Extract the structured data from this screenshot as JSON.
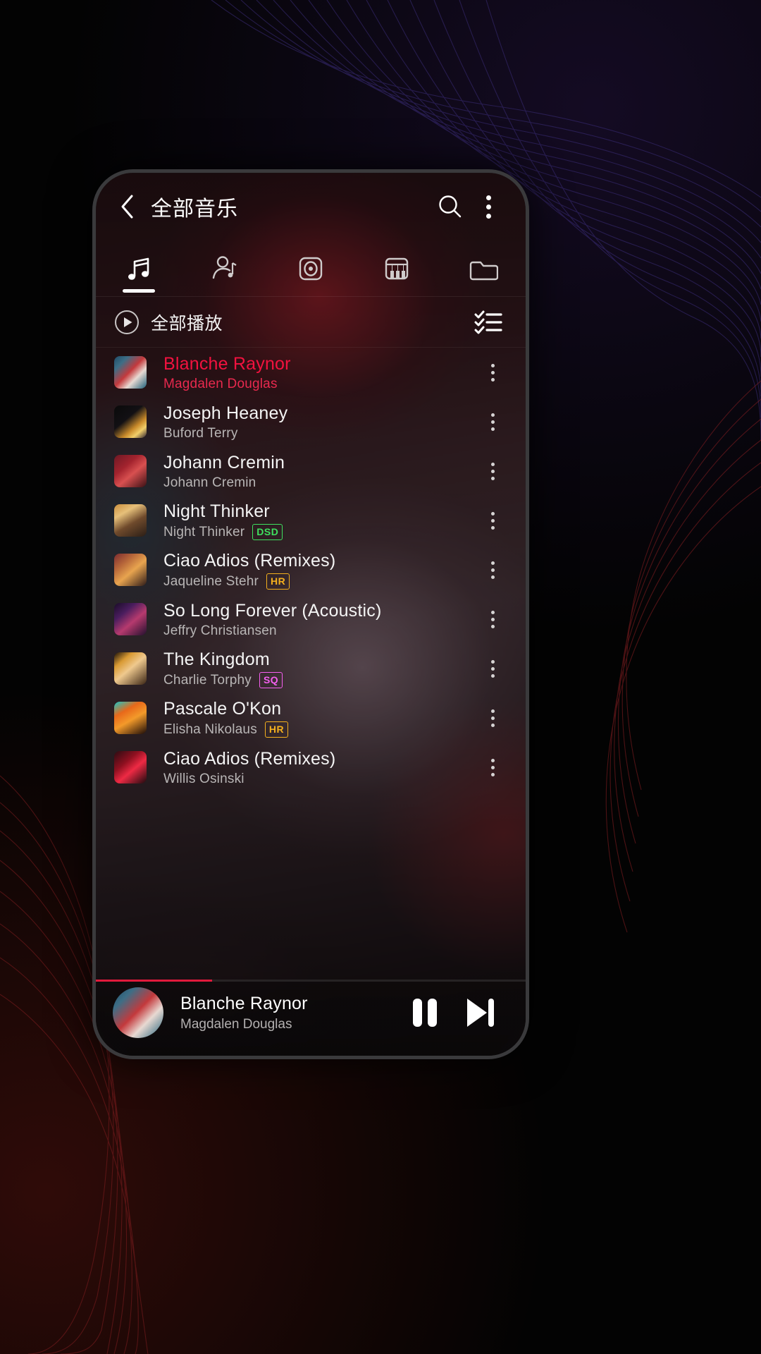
{
  "header": {
    "title": "全部音乐",
    "back_icon": "chevron-left-icon",
    "search_icon": "search-icon",
    "overflow_icon": "kebab-menu-icon"
  },
  "tabs": [
    {
      "name": "songs",
      "icon": "music-note-icon",
      "active": true
    },
    {
      "name": "artists",
      "icon": "artist-note-icon",
      "active": false
    },
    {
      "name": "albums",
      "icon": "album-disc-icon",
      "active": false
    },
    {
      "name": "genres",
      "icon": "piano-keys-icon",
      "active": false
    },
    {
      "name": "folders",
      "icon": "folder-icon",
      "active": false
    }
  ],
  "play_all": {
    "label": "全部播放",
    "play_icon": "play-circle-icon",
    "multiselect_icon": "checklist-icon"
  },
  "badge_colors": {
    "DSD": "#3fe05f",
    "HR": "#f4b01e",
    "SQ": "#f55ff0"
  },
  "accent_color": "#f2123f",
  "songs": [
    {
      "title": "Blanche Raynor",
      "artist": "Magdalen Douglas",
      "badge": "",
      "active": true,
      "art": "linear-gradient(135deg,#1f4a66 0%,#3d6e86 22%,#c4393c 48%,#e8d9d2 68%,#1c5f78 100%)"
    },
    {
      "title": "Joseph Heaney",
      "artist": "Buford Terry",
      "badge": "",
      "active": false,
      "art": "linear-gradient(140deg,#0a0a0a 0%,#121014 40%,#c98a2a 66%,#f2cf6a 80%,#2a2030 100%)"
    },
    {
      "title": "Johann Cremin",
      "artist": "Johann Cremin",
      "badge": "",
      "active": false,
      "art": "linear-gradient(140deg,#6d1824 0%,#a3232e 35%,#d85050 58%,#3a1014 100%)"
    },
    {
      "title": "Night Thinker",
      "artist": "Night Thinker",
      "badge": "DSD",
      "active": false,
      "art": "linear-gradient(150deg,#c98f3c 0%,#e6c07a 28%,#6f4a2c 58%,#2a1d16 100%)"
    },
    {
      "title": "Ciao Adios (Remixes)",
      "artist": "Jaqueline Stehr",
      "badge": "HR",
      "active": false,
      "art": "linear-gradient(140deg,#7b2a2f 0%,#b8683a 30%,#e8a44f 55%,#2d1a18 100%)"
    },
    {
      "title": "So Long Forever (Acoustic)",
      "artist": "Jeffry Christiansen",
      "badge": "",
      "active": false,
      "art": "linear-gradient(140deg,#1a0c28 0%,#4a1d5e 30%,#b63a6e 58%,#22102e 100%)"
    },
    {
      "title": "The Kingdom",
      "artist": "Charlie Torphy",
      "badge": "SQ",
      "active": false,
      "art": "linear-gradient(140deg,#1a1008 0%,#d99a33 26%,#efc98e 50%,#3a2414 100%)"
    },
    {
      "title": "Pascale O'Kon",
      "artist": "Elisha Nikolaus",
      "badge": "HR",
      "active": false,
      "art": "linear-gradient(150deg,#17c8c8 0%,#e8681a 30%,#f39a2a 55%,#1a0b08 100%)"
    },
    {
      "title": "Ciao Adios (Remixes)",
      "artist": "Willis Osinski",
      "badge": "",
      "active": false,
      "art": "linear-gradient(140deg,#2a0c12 0%,#8f1020 35%,#ee2a44 58%,#1b0a0e 100%)"
    }
  ],
  "now_playing": {
    "title": "Blanche Raynor",
    "artist": "Magdalen Douglas",
    "progress_percent": 27,
    "pause_icon": "pause-icon",
    "next_icon": "skip-next-icon",
    "art": "linear-gradient(135deg,#1f4a66 0%,#3d6e86 22%,#c4393c 48%,#e8d9d2 68%,#1c5f78 100%)"
  }
}
